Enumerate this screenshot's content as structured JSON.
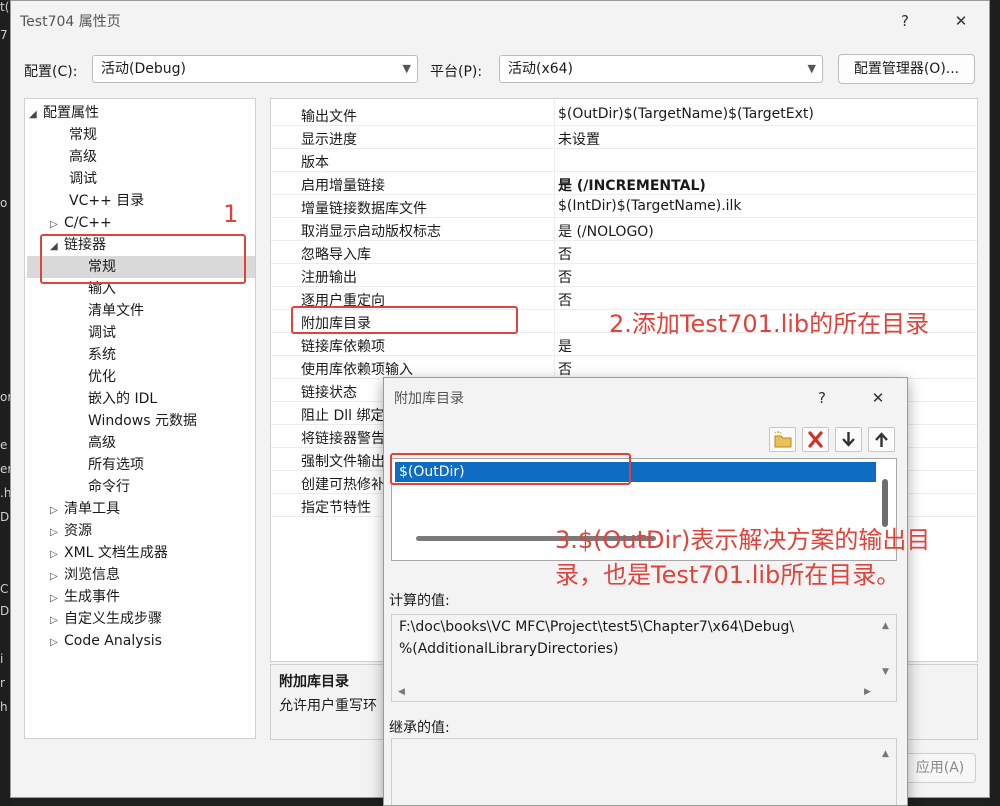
{
  "window": {
    "title": "Test704 属性页",
    "help": "?",
    "close": "✕"
  },
  "toolbar": {
    "config_label": "配置(C):",
    "config_value": "活动(Debug)",
    "platform_label": "平台(P):",
    "platform_value": "活动(x64)",
    "config_manager": "配置管理器(O)..."
  },
  "tree": {
    "items": [
      {
        "label": "配置属性",
        "twisty": "◢"
      },
      {
        "label": "常规"
      },
      {
        "label": "高级"
      },
      {
        "label": "调试"
      },
      {
        "label": "VC++ 目录"
      },
      {
        "label": "C/C++",
        "twisty": "▷"
      },
      {
        "label": "链接器",
        "twisty": "◢"
      },
      {
        "label": "常规"
      },
      {
        "label": "输入"
      },
      {
        "label": "清单文件"
      },
      {
        "label": "调试"
      },
      {
        "label": "系统"
      },
      {
        "label": "优化"
      },
      {
        "label": "嵌入的 IDL"
      },
      {
        "label": "Windows 元数据"
      },
      {
        "label": "高级"
      },
      {
        "label": "所有选项"
      },
      {
        "label": "命令行"
      },
      {
        "label": "清单工具",
        "twisty": "▷"
      },
      {
        "label": "资源",
        "twisty": "▷"
      },
      {
        "label": "XML 文档生成器",
        "twisty": "▷"
      },
      {
        "label": "浏览信息",
        "twisty": "▷"
      },
      {
        "label": "生成事件",
        "twisty": "▷"
      },
      {
        "label": "自定义生成步骤",
        "twisty": "▷"
      },
      {
        "label": "Code Analysis",
        "twisty": "▷"
      }
    ]
  },
  "grid": {
    "rows": [
      {
        "name": "输出文件",
        "value": "$(OutDir)$(TargetName)$(TargetExt)"
      },
      {
        "name": "显示进度",
        "value": "未设置"
      },
      {
        "name": "版本",
        "value": ""
      },
      {
        "name": "启用增量链接",
        "value": "是 (/INCREMENTAL)",
        "bold": true
      },
      {
        "name": "增量链接数据库文件",
        "value": "$(IntDir)$(TargetName).ilk"
      },
      {
        "name": "取消显示启动版权标志",
        "value": "是 (/NOLOGO)"
      },
      {
        "name": "忽略导入库",
        "value": "否"
      },
      {
        "name": "注册输出",
        "value": "否"
      },
      {
        "name": "逐用户重定向",
        "value": "否"
      },
      {
        "name": "附加库目录",
        "value": ""
      },
      {
        "name": "链接库依赖项",
        "value": "是"
      },
      {
        "name": "使用库依赖项输入",
        "value": "否"
      },
      {
        "name": "链接状态",
        "value": ""
      },
      {
        "name": "阻止 Dll 绑定",
        "value": ""
      },
      {
        "name": "将链接器警告",
        "value": ""
      },
      {
        "name": "强制文件输出",
        "value": ""
      },
      {
        "name": "创建可热修补",
        "value": ""
      },
      {
        "name": "指定节特性",
        "value": ""
      }
    ]
  },
  "description": {
    "title": "附加库目录",
    "text": "允许用户重写环"
  },
  "apply_button": "应用(A)",
  "annotations": {
    "step1": "1",
    "step2": "2.添加Test701.lib的所在目录",
    "step3_line1": "3.$(OutDir)表示解决方案的输出目",
    "step3_line2": "录，也是Test701.lib所在目录。"
  },
  "subdialog": {
    "title": "附加库目录",
    "help": "?",
    "close": "✕",
    "list_items": [
      "$(OutDir)"
    ],
    "calc_label": "计算的值:",
    "calc_line1": "F:\\doc\\books\\VC MFC\\Project\\test5\\Chapter7\\x64\\Debug\\",
    "calc_line2": "%(AdditionalLibraryDirectories)",
    "inherited_label": "继承的值:"
  },
  "ide_background": {
    "fragments": [
      "t(",
      "7",
      "o",
      "or",
      "e",
      "er",
      ".h",
      "D",
      "C",
      "D",
      "i",
      "r",
      "h"
    ]
  },
  "colors": {
    "annotation_red": "#e0433c",
    "selection_blue": "#0e6dc3"
  }
}
